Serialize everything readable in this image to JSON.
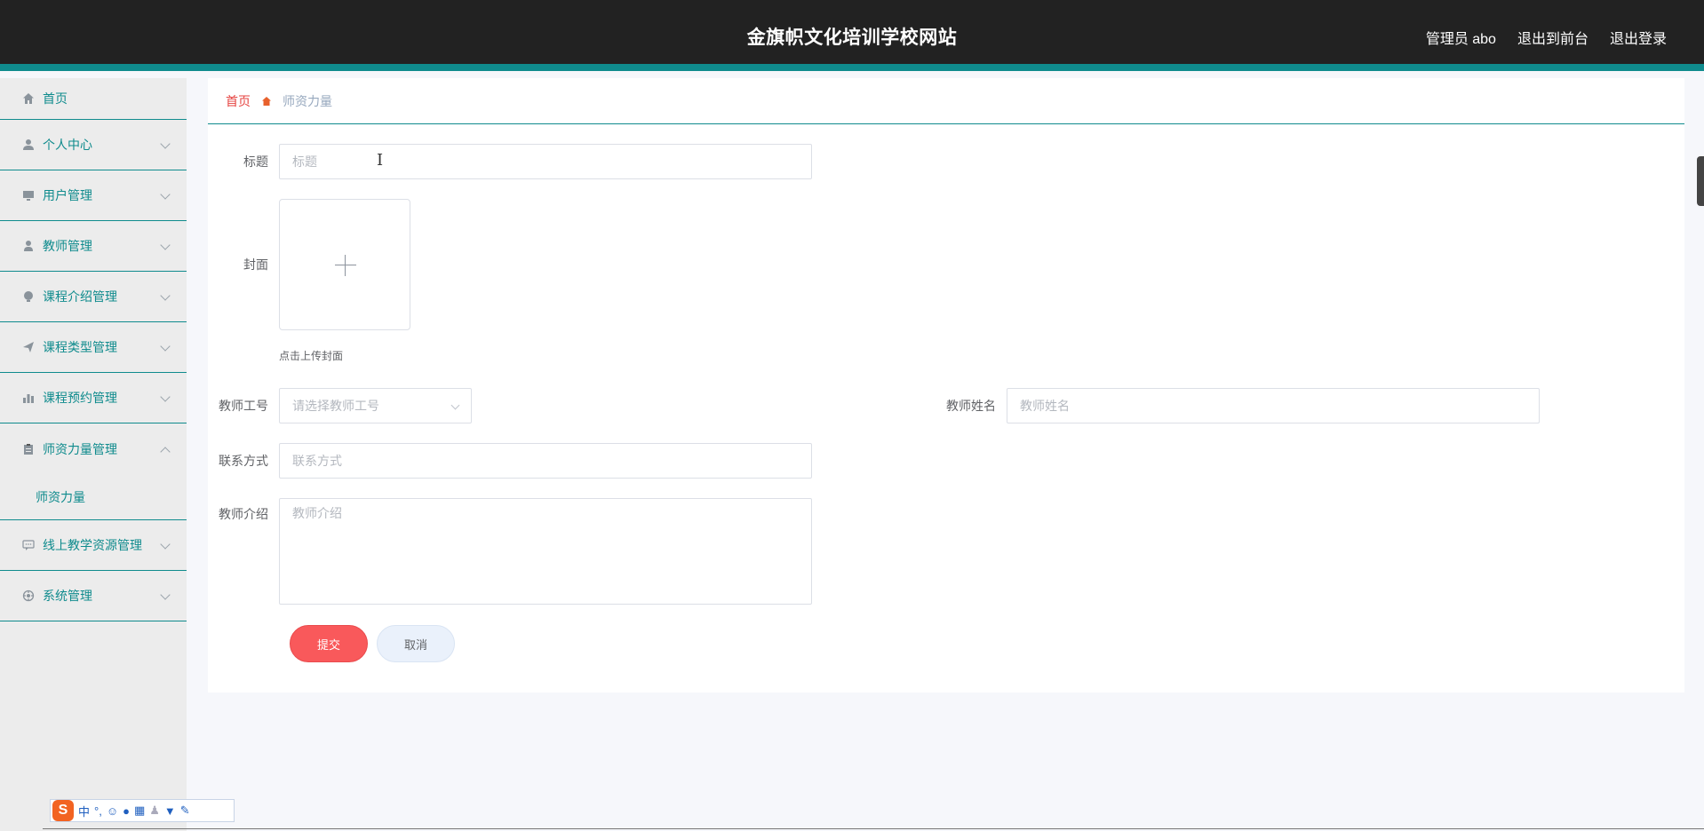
{
  "header": {
    "site_title": "金旗帜文化培训学校网站",
    "user_label": "管理员 abo",
    "to_front": "退出到前台",
    "logout": "退出登录"
  },
  "sidebar": {
    "items": [
      {
        "label": "首页",
        "icon": "home-icon"
      },
      {
        "label": "个人中心",
        "icon": "user-icon"
      },
      {
        "label": "用户管理",
        "icon": "monitor-icon"
      },
      {
        "label": "教师管理",
        "icon": "teacher-icon"
      },
      {
        "label": "课程介绍管理",
        "icon": "bulb-icon"
      },
      {
        "label": "课程类型管理",
        "icon": "paper-plane-icon"
      },
      {
        "label": "课程预约管理",
        "icon": "bar-chart-icon"
      },
      {
        "label": "师资力量管理",
        "icon": "clipboard-icon"
      },
      {
        "label": "线上教学资源管理",
        "icon": "chat-icon"
      },
      {
        "label": "系统管理",
        "icon": "settings-icon"
      }
    ],
    "sub_item": "师资力量",
    "accent_color": "#0f8b8d"
  },
  "breadcrumb": {
    "home": "首页",
    "current": "师资力量"
  },
  "form": {
    "title_label": "标题",
    "title_placeholder": "标题",
    "cover_label": "封面",
    "cover_hint": "点击上传封面",
    "teacher_no_label": "教师工号",
    "teacher_no_placeholder": "请选择教师工号",
    "teacher_name_label": "教师姓名",
    "teacher_name_placeholder": "教师姓名",
    "contact_label": "联系方式",
    "contact_placeholder": "联系方式",
    "intro_label": "教师介绍",
    "intro_placeholder": "教师介绍",
    "submit": "提交",
    "cancel": "取消",
    "submit_color": "#f9595b"
  },
  "ime": {
    "logo": "S",
    "mode": "中"
  }
}
